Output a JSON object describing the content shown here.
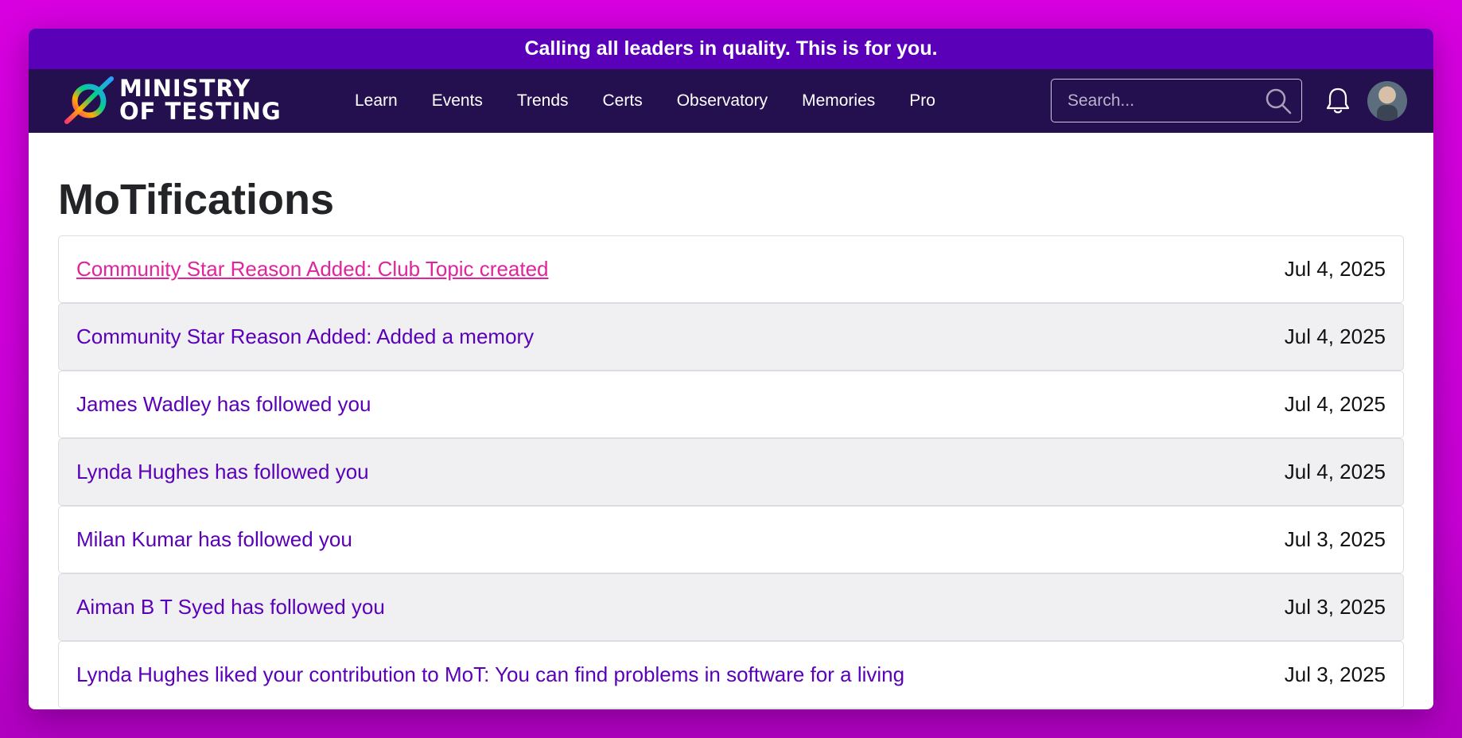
{
  "promo": {
    "text": "Calling all leaders in quality. This is for you."
  },
  "brand": {
    "line1": "MINISTRY",
    "line2": "OF TESTING"
  },
  "nav": {
    "items": [
      "Learn",
      "Events",
      "Trends",
      "Certs",
      "Observatory",
      "Memories",
      "Pro"
    ]
  },
  "search": {
    "placeholder": "Search..."
  },
  "page": {
    "title": "MoTifications"
  },
  "notifications": [
    {
      "text": "Community Star Reason Added: Club Topic created",
      "date": "Jul 4, 2025"
    },
    {
      "text": "Community Star Reason Added: Added a memory",
      "date": "Jul 4, 2025"
    },
    {
      "text": "James Wadley has followed you",
      "date": "Jul 4, 2025"
    },
    {
      "text": "Lynda Hughes has followed you",
      "date": "Jul 4, 2025"
    },
    {
      "text": "Milan Kumar has followed you",
      "date": "Jul 3, 2025"
    },
    {
      "text": "Aiman B T Syed has followed you",
      "date": "Jul 3, 2025"
    },
    {
      "text": "Lynda Hughes liked your contribution to MoT: You can find problems in software for a living",
      "date": "Jul 3, 2025"
    }
  ],
  "colors": {
    "background": "#d800e0",
    "promo_bar": "#5a00b8",
    "nav_bar": "#24104f",
    "link": "#5a00b8",
    "link_hover": "#e0249c",
    "row_alt": "#f0f0f3"
  },
  "icons": [
    "ministry-of-testing-logo",
    "search-icon",
    "bell-icon",
    "avatar"
  ]
}
